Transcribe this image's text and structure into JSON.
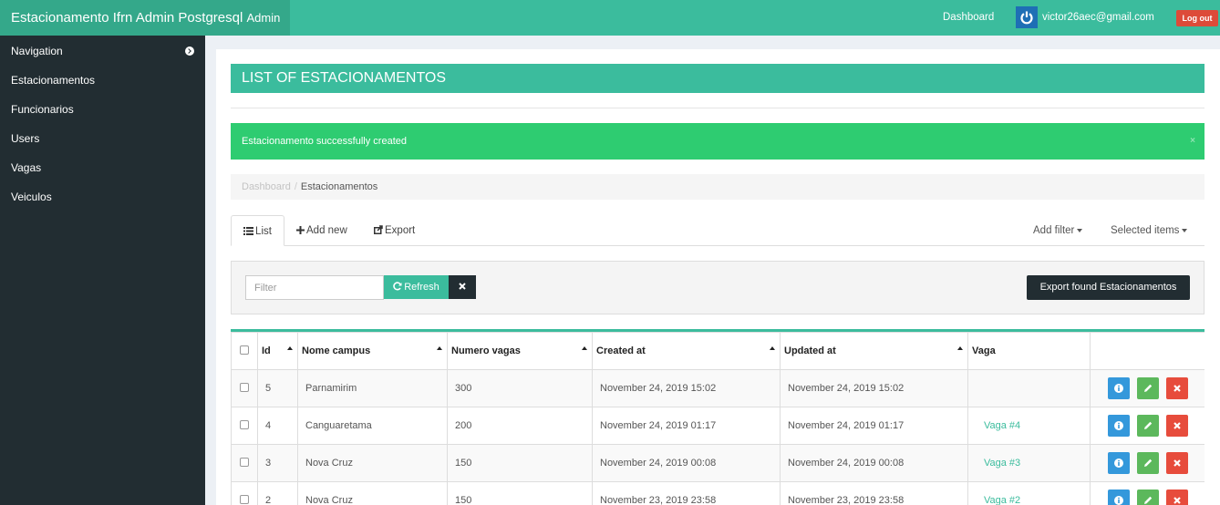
{
  "app": {
    "brand_main": "Estacionamento Ifrn Admin Postgresql",
    "brand_sub": "Admin",
    "dashboard_link": "Dashboard",
    "user_email": "victor26aec@gmail.com",
    "logout_label": "Log out"
  },
  "sidebar": {
    "items": [
      {
        "label": "Navigation",
        "icon": "chevron-right-circle-icon"
      },
      {
        "label": "Estacionamentos"
      },
      {
        "label": "Funcionarios"
      },
      {
        "label": "Users"
      },
      {
        "label": "Vagas"
      },
      {
        "label": "Veiculos"
      }
    ]
  },
  "page": {
    "title": "LIST OF ESTACIONAMENTOS",
    "alert": "Estacionamento successfully created",
    "alert_close": "×",
    "breadcrumb": [
      "Dashboard",
      "Estacionamentos"
    ],
    "breadcrumb_sep": "/"
  },
  "tabs": {
    "list": "List",
    "add_new": "Add new",
    "export": "Export",
    "add_filter": "Add filter",
    "selected_items": "Selected items"
  },
  "filter": {
    "placeholder": "Filter",
    "value": "",
    "refresh_label": "Refresh",
    "export_found_label": "Export found Estacionamentos"
  },
  "table": {
    "columns": [
      "Id",
      "Nome campus",
      "Numero vagas",
      "Created at",
      "Updated at",
      "Vaga"
    ],
    "rows": [
      {
        "id": "5",
        "nome_campus": "Parnamirim",
        "numero_vagas": "300",
        "created_at": "November 24, 2019 15:02",
        "updated_at": "November 24, 2019 15:02",
        "vaga": ""
      },
      {
        "id": "4",
        "nome_campus": "Canguaretama",
        "numero_vagas": "200",
        "created_at": "November 24, 2019 01:17",
        "updated_at": "November 24, 2019 01:17",
        "vaga": "Vaga #4"
      },
      {
        "id": "3",
        "nome_campus": "Nova Cruz",
        "numero_vagas": "150",
        "created_at": "November 24, 2019 00:08",
        "updated_at": "November 24, 2019 00:08",
        "vaga": "Vaga #3"
      },
      {
        "id": "2",
        "nome_campus": "Nova Cruz",
        "numero_vagas": "150",
        "created_at": "November 23, 2019 23:58",
        "updated_at": "November 23, 2019 23:58",
        "vaga": "Vaga #2"
      }
    ]
  },
  "colors": {
    "accent": "#3bbc9d",
    "sidebar": "#222d32",
    "success": "#2ecc71",
    "danger": "#e74c3c",
    "info": "#3498db",
    "edit": "#5cb85c"
  }
}
